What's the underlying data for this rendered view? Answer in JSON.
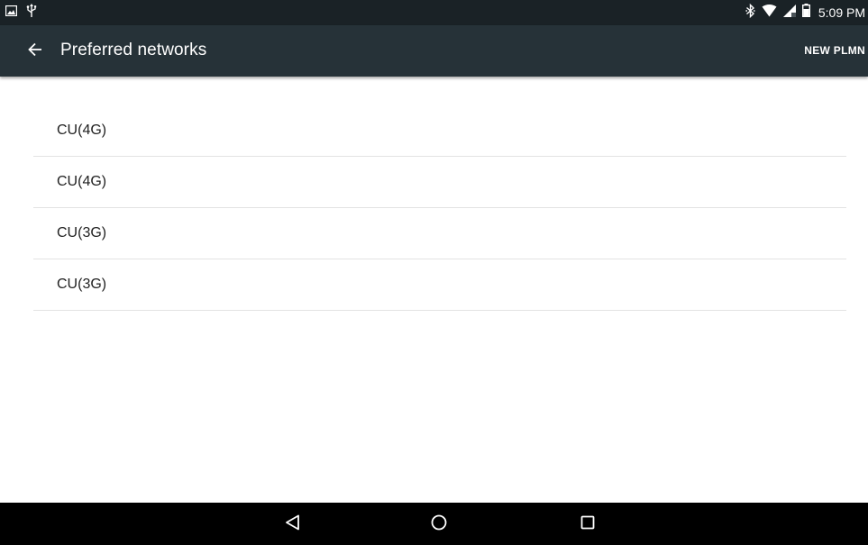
{
  "status_bar": {
    "time": "5:09 PM",
    "left_icons": [
      "image-notification-icon",
      "usb-icon"
    ],
    "right_icons": [
      "bluetooth-icon",
      "wifi-icon",
      "cell-signal-icon",
      "battery-icon"
    ]
  },
  "toolbar": {
    "title": "Preferred networks",
    "back_icon": "arrow-back-icon",
    "action_label": "NEW PLMN",
    "background": "#263238"
  },
  "networks": {
    "items": [
      {
        "label": "CU(4G)"
      },
      {
        "label": "CU(4G)"
      },
      {
        "label": "CU(3G)"
      },
      {
        "label": "CU(3G)"
      }
    ]
  },
  "nav_bar": {
    "buttons": [
      "back-triangle-icon",
      "home-circle-icon",
      "recents-square-icon"
    ]
  }
}
